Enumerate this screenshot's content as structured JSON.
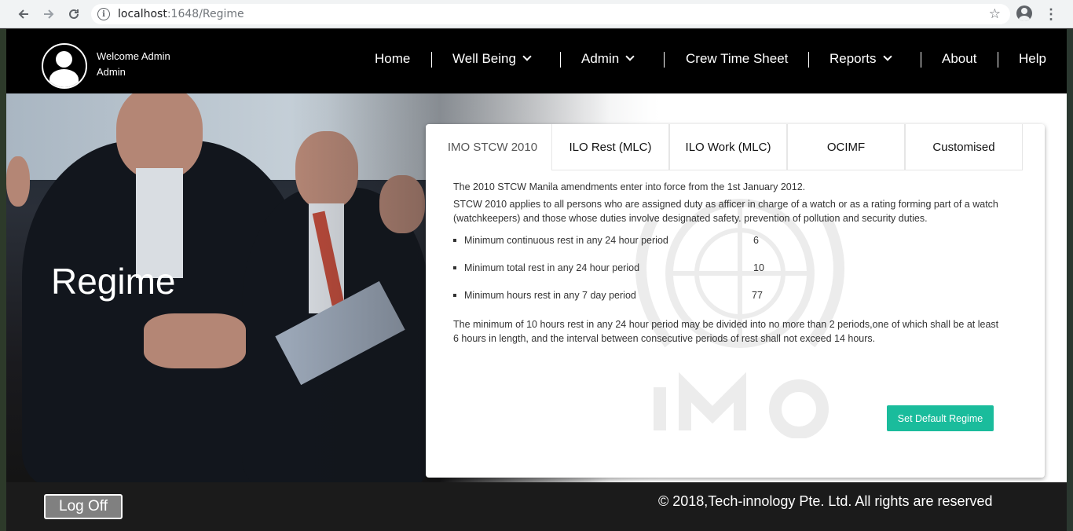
{
  "browser": {
    "url_host": "localhost",
    "url_path": ":1648/Regime"
  },
  "header": {
    "welcome_line": "Welcome Admin",
    "role_line": "Admin",
    "nav": {
      "home": "Home",
      "well_being": "Well Being",
      "admin": "Admin",
      "crew_time_sheet": "Crew Time Sheet",
      "reports": "Reports",
      "about": "About",
      "help": "Help"
    }
  },
  "hero": {
    "title": "Regime"
  },
  "tabs": [
    {
      "label": "IMO STCW 2010",
      "active": true
    },
    {
      "label": "ILO Rest (MLC)",
      "active": false
    },
    {
      "label": "ILO Work (MLC)",
      "active": false
    },
    {
      "label": "OCIMF",
      "active": false
    },
    {
      "label": "Customised",
      "active": false
    }
  ],
  "content": {
    "intro_1": "The 2010 STCW Manila amendments enter into force from the 1st January 2012.",
    "intro_2": "STCW 2010 applies to all persons who are assigned duty as afficer in charge of a watch or as a rating forming part of a watch (watchkeepers) and those whose duties involve designated safety. prevention of pollution and security duties.",
    "rules": [
      {
        "label": "Minimum continuous rest in any 24 hour period",
        "value": "6"
      },
      {
        "label": "Minimum total rest in any 24 hour period",
        "value": "10"
      },
      {
        "label": "Minimum hours rest in any 7 day period",
        "value": "77"
      }
    ],
    "note": "The minimum of 10 hours rest in any 24 hour period may be divided into no more than 2 periods,one of which shall be at least 6 hours in length, and the interval between consecutive periods of rest shall not exceed 14 hours.",
    "default_button": "Set Default Regime"
  },
  "footer": {
    "logoff": "Log Off",
    "copyright": "© 2018,Tech-innology Pte. Ltd. All rights are reserved"
  },
  "colors": {
    "header_bg": "#000000",
    "accent_button": "#1abc9c",
    "footer_bg": "#1b1b1b"
  },
  "icons": [
    "back-arrow-icon",
    "forward-arrow-icon",
    "reload-icon",
    "info-icon",
    "star-icon",
    "account-icon",
    "menu-kebab-icon",
    "user-avatar-icon",
    "chevron-down-icon"
  ]
}
